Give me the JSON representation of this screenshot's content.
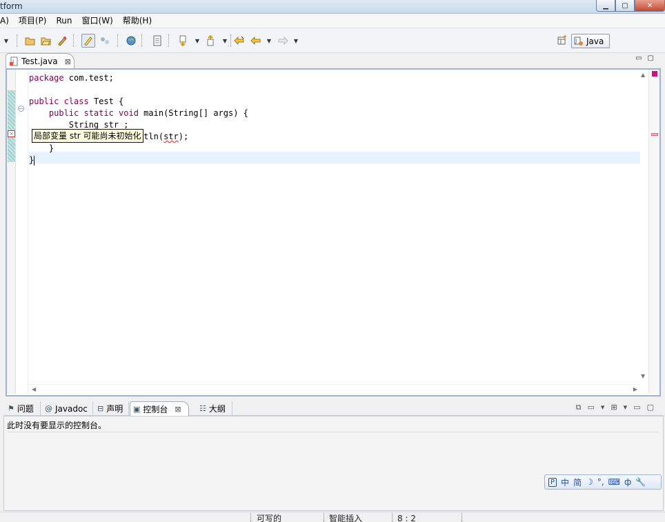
{
  "window": {
    "title": "tform",
    "minimize_glyph": "▁",
    "maximize_glyph": "▢",
    "close_glyph": "✕"
  },
  "menu": {
    "items": [
      "A)",
      "项目(P)",
      "Run",
      "窗口(W)",
      "帮助(H)"
    ]
  },
  "toolbar": {
    "icons": [
      "dropdown-arrow",
      "open-project-icon",
      "open-file-icon",
      "run-icon",
      "toggle-mark-occurrences-icon",
      "toggle-block-icon",
      "globe-icon",
      "task-list-icon",
      "next-annotation-icon",
      "previous-annotation-icon",
      "last-edit-location-icon",
      "back-icon",
      "forward-icon"
    ],
    "perspective_label": "Java"
  },
  "editor": {
    "tab_label": "Test.java",
    "code_lines": [
      {
        "kw": "package",
        "rest": " com.test;"
      },
      {
        "kw": "",
        "rest": ""
      },
      {
        "kw": "public class",
        "rest": " Test {"
      },
      {
        "kw": "    public static void",
        "rest": " main(String[] args) {"
      },
      {
        "kw": "",
        "rest": "        String str ;"
      },
      {
        "kw": "",
        "rest": "        System.out.println(",
        "err": "str",
        "tail": ");"
      },
      {
        "kw": "",
        "rest": "    }"
      },
      {
        "kw": "",
        "rest": "}"
      }
    ],
    "tooltip": "局部变量 str 可能尚未初始化",
    "cursor_position": "8 : 2"
  },
  "bottom": {
    "tabs": [
      {
        "label": "问题",
        "icon": "problems-icon"
      },
      {
        "label": "Javadoc",
        "icon": "at-icon"
      },
      {
        "label": "声明",
        "icon": "declaration-icon"
      },
      {
        "label": "控制台",
        "icon": "console-icon"
      },
      {
        "label": "大纲",
        "icon": "outline-icon"
      }
    ],
    "console_message": "此时没有要显示的控制台。"
  },
  "ime": {
    "items": [
      "中",
      "简",
      "☽",
      "°,",
      "⌨",
      "ф",
      "🔧"
    ]
  },
  "status": {
    "writable": "可写的",
    "insert_mode": "智能插入",
    "position": "8 : 2"
  }
}
